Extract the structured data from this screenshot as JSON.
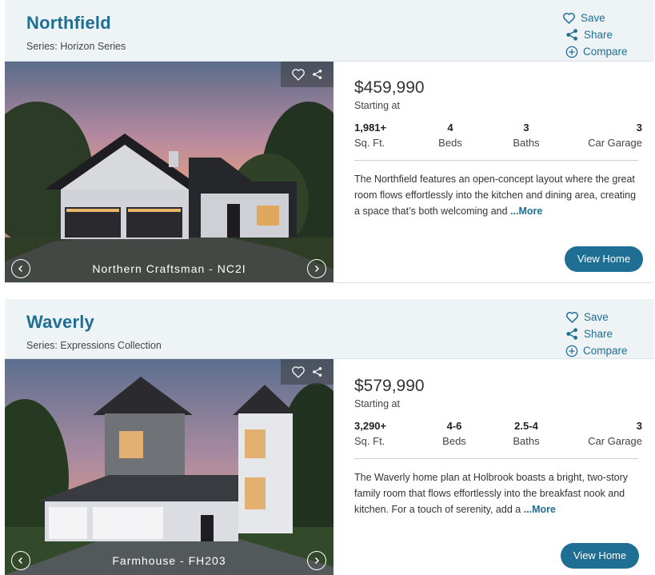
{
  "homes": [
    {
      "name": "Northfield",
      "series": "Series: Horizon Series",
      "actions": {
        "save": "Save",
        "share": "Share",
        "compare": "Compare"
      },
      "price": "$459,990",
      "price_label": "Starting at",
      "stats": [
        {
          "value": "1,981+",
          "label": "Sq. Ft."
        },
        {
          "value": "4",
          "label": "Beds"
        },
        {
          "value": "3",
          "label": "Baths"
        },
        {
          "value": "3",
          "label": "Car Garage"
        }
      ],
      "description": "The Northfield features an open-concept layout where the great room flows effortlessly into the kitchen and dining area, creating a space that’s both welcoming and ",
      "more": "...More",
      "caption": "Northern Craftsman - NC2I",
      "cta": "View Home"
    },
    {
      "name": "Waverly",
      "series": "Series: Expressions Collection",
      "actions": {
        "save": "Save",
        "share": "Share",
        "compare": "Compare"
      },
      "price": "$579,990",
      "price_label": "Starting at",
      "stats": [
        {
          "value": "3,290+",
          "label": "Sq. Ft."
        },
        {
          "value": "4-6",
          "label": "Beds"
        },
        {
          "value": "2.5-4",
          "label": "Baths"
        },
        {
          "value": "3",
          "label": "Car Garage"
        }
      ],
      "description": "The Waverly home plan at Holbrook boasts a bright, two-story family room that flows effortlessly into the breakfast nook and kitchen. For a touch of serenity, add a ",
      "more": "...More",
      "caption": "Farmhouse - FH203",
      "cta": "View Home"
    }
  ],
  "icons": {
    "save": "heart-icon",
    "share": "share-icon",
    "compare": "plus-circle-icon",
    "prev": "chevron-left-icon",
    "next": "chevron-right-icon"
  },
  "colors": {
    "accent": "#1f6e93",
    "header_bg": "#eef3f6",
    "button_bg": "#1f6e93"
  }
}
